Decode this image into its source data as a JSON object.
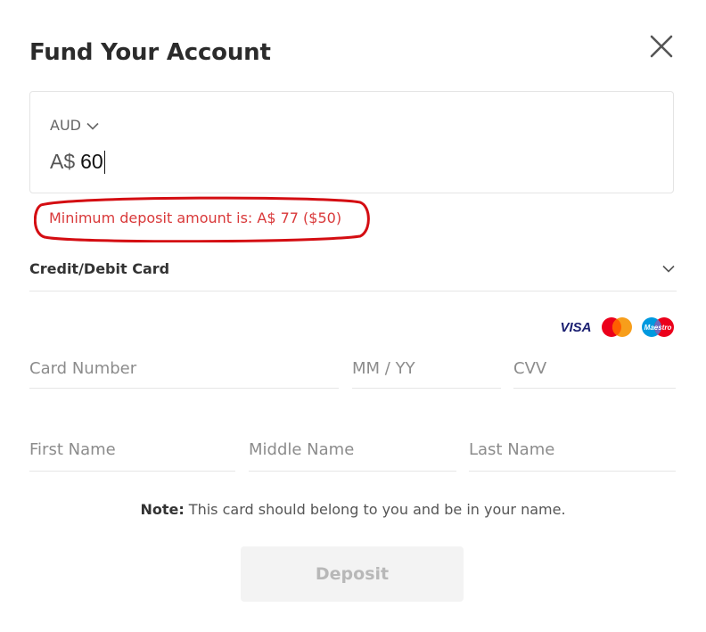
{
  "dialog": {
    "title": "Fund Your Account"
  },
  "amount": {
    "currency": "AUD",
    "prefix": "A$",
    "value": "60"
  },
  "error": {
    "message": "Minimum deposit amount is: A$ 77 ($50)"
  },
  "payment_method": {
    "label": "Credit/Debit Card"
  },
  "card_logos": [
    "VISA",
    "Maestro"
  ],
  "card_fields": {
    "card_number_placeholder": "Card Number",
    "expiry_placeholder": "MM / YY",
    "cvv_placeholder": "CVV"
  },
  "name_fields": {
    "first_placeholder": "First Name",
    "middle_placeholder": "Middle Name",
    "last_placeholder": "Last Name"
  },
  "note": {
    "bold": "Note:",
    "text": " This card should belong to you and be in your name."
  },
  "deposit_button": {
    "label": "Deposit"
  },
  "colors": {
    "error": "#d9393a",
    "visa_blue": "#1a1f71",
    "mastercard_red": "#eb001b",
    "mastercard_yellow": "#f79e1b",
    "maestro_blue": "#0099df",
    "disabled_button_bg": "#f3f3f3"
  }
}
